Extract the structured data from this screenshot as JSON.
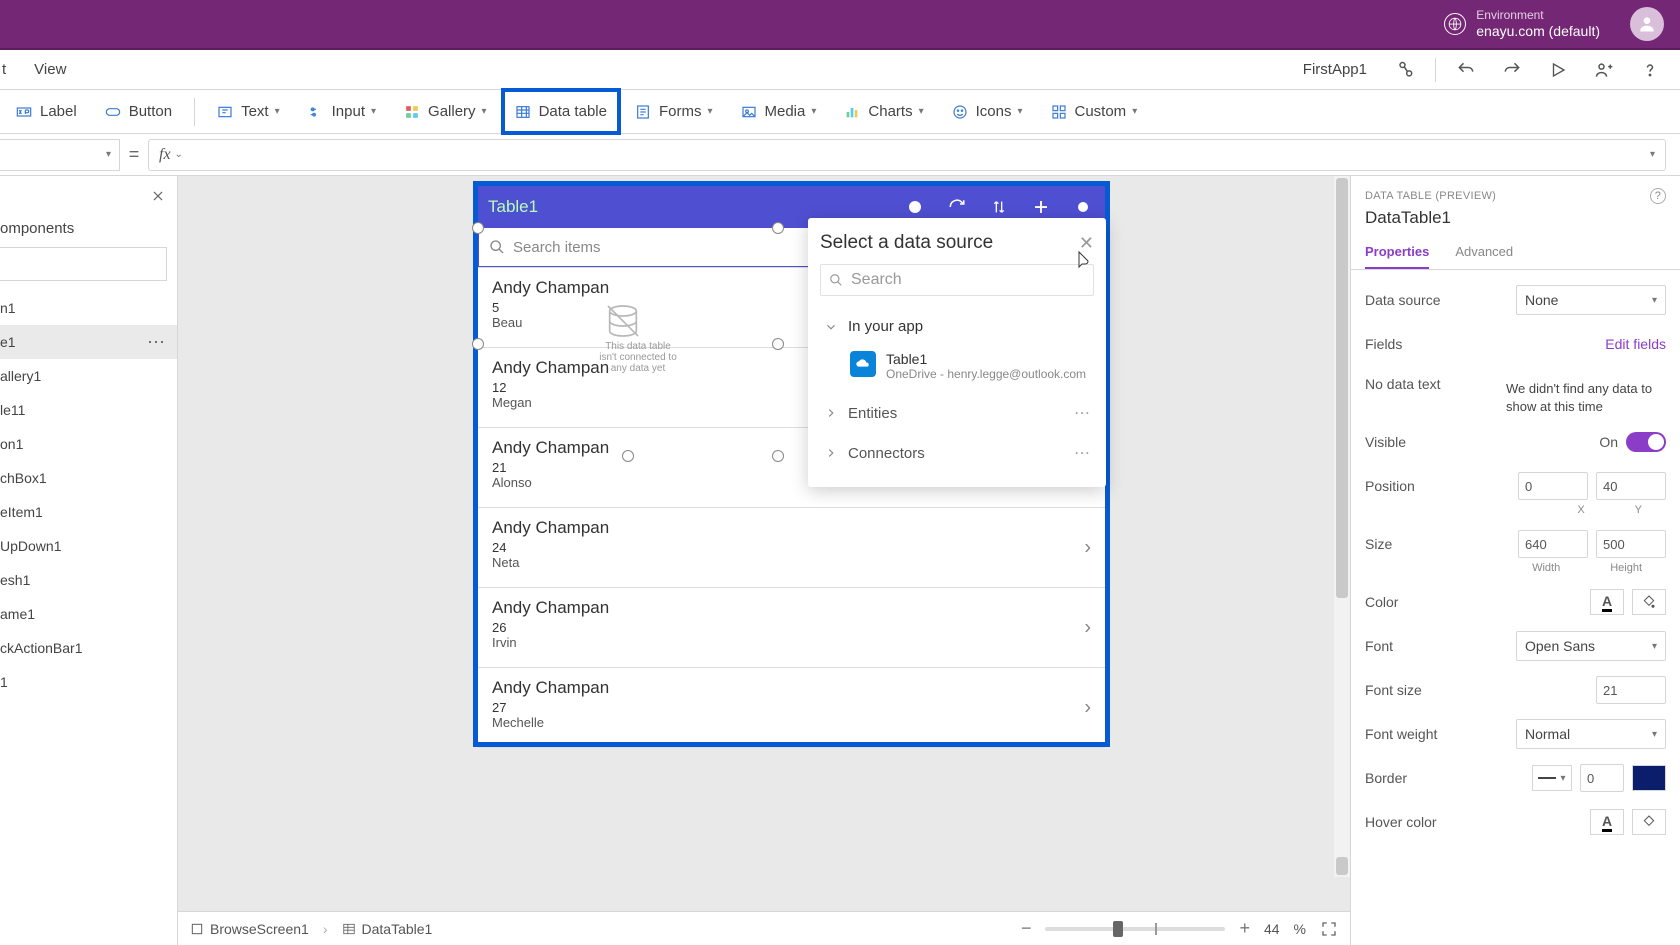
{
  "header": {
    "env_label": "Environment",
    "env_name": "enayu.com (default)"
  },
  "menubar": {
    "insert": "t",
    "view": "View",
    "app_name": "FirstApp1"
  },
  "ribbon": {
    "label_btn": "Label",
    "button_btn": "Button",
    "text": "Text",
    "input": "Input",
    "gallery": "Gallery",
    "data_table": "Data table",
    "forms": "Forms",
    "media": "Media",
    "charts": "Charts",
    "icons": "Icons",
    "custom": "Custom"
  },
  "tree": {
    "components": "omponents",
    "items": [
      {
        "label": "n1"
      },
      {
        "label": "e1",
        "selected": true
      },
      {
        "label": "allery1"
      },
      {
        "label": "le11"
      },
      {
        "label": "on1"
      },
      {
        "label": "chBox1"
      },
      {
        "label": "eItem1"
      },
      {
        "label": "UpDown1"
      },
      {
        "label": "esh1"
      },
      {
        "label": "ame1"
      },
      {
        "label": "ckActionBar1"
      },
      {
        "label": "1"
      }
    ]
  },
  "canvas": {
    "app_title": "Table1",
    "search_placeholder": "Search items",
    "gallery_rows": [
      {
        "name": "Andy Champan",
        "num": "5",
        "sub": "Beau"
      },
      {
        "name": "Andy Champan",
        "num": "12",
        "sub": "Megan"
      },
      {
        "name": "Andy Champan",
        "num": "21",
        "sub": "Alonso"
      },
      {
        "name": "Andy Champan",
        "num": "24",
        "sub": "Neta"
      },
      {
        "name": "Andy Champan",
        "num": "26",
        "sub": "Irvin"
      },
      {
        "name": "Andy Champan",
        "num": "27",
        "sub": "Mechelle"
      }
    ],
    "dt_empty_text": "This data table isn't connected to any data yet"
  },
  "data_source": {
    "title": "Select a data source",
    "search_placeholder": "Search",
    "in_your_app": "In your app",
    "table": {
      "name": "Table1",
      "sub": "OneDrive - henry.legge@outlook.com"
    },
    "entities": "Entities",
    "connectors": "Connectors"
  },
  "status": {
    "crumb1": "BrowseScreen1",
    "crumb2": "DataTable1",
    "zoom_value": "44",
    "zoom_pct": "%"
  },
  "props": {
    "category": "DATA TABLE (PREVIEW)",
    "name": "DataTable1",
    "tabs": {
      "properties": "Properties",
      "advanced": "Advanced"
    },
    "data_source_label": "Data source",
    "data_source_value": "None",
    "fields_label": "Fields",
    "edit_fields": "Edit fields",
    "no_data_label": "No data text",
    "no_data_value": "We didn't find any data to show at this time",
    "visible_label": "Visible",
    "visible_value": "On",
    "position_label": "Position",
    "pos_x": "0",
    "pos_y": "40",
    "pos_xl": "X",
    "pos_yl": "Y",
    "size_label": "Size",
    "size_w": "640",
    "size_h": "500",
    "size_wl": "Width",
    "size_hl": "Height",
    "color_label": "Color",
    "font_label": "Font",
    "font_value": "Open Sans",
    "font_size_label": "Font size",
    "font_size_value": "21",
    "font_weight_label": "Font weight",
    "font_weight_value": "Normal",
    "border_label": "Border",
    "border_width": "0",
    "hover_color_label": "Hover color"
  }
}
